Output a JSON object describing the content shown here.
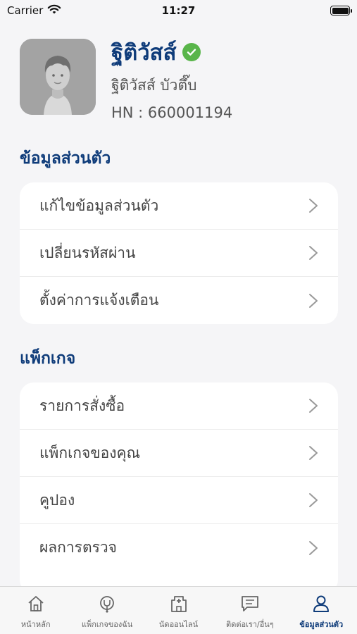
{
  "status_bar": {
    "carrier": "Carrier",
    "time": "11:27"
  },
  "profile": {
    "display_name": "ฐิติวัสส์",
    "full_name": "ฐิติวัสส์ บัวตึ๊บ",
    "hn": "HN : 660001194"
  },
  "sections": {
    "personal": {
      "title": "ข้อมูลส่วนตัว",
      "items": [
        "แก้ไขข้อมูลส่วนตัว",
        "เปลี่ยนรหัสผ่าน",
        "ตั้งค่าการแจ้งเตือน"
      ]
    },
    "package": {
      "title": "แพ็กเกจ",
      "items": [
        "รายการสั่งซื้อ",
        "แพ็กเกจของคุณ",
        "คูปอง",
        "ผลการตรวจ"
      ]
    }
  },
  "tab_bar": {
    "tabs": [
      {
        "label": "หน้าหลัก",
        "icon": "home-icon"
      },
      {
        "label": "แพ็กเกจของฉัน",
        "icon": "stethoscope-icon"
      },
      {
        "label": "นัดออนไลน์",
        "icon": "hospital-icon"
      },
      {
        "label": "ติดต่อเรา/อื่นๆ",
        "icon": "chat-icon"
      },
      {
        "label": "ข้อมูลส่วนตัว",
        "icon": "person-icon"
      }
    ],
    "active_index": 4
  },
  "colors": {
    "accent": "#0f3c7a",
    "verified": "#59b54a",
    "background": "#f5f5f7"
  }
}
